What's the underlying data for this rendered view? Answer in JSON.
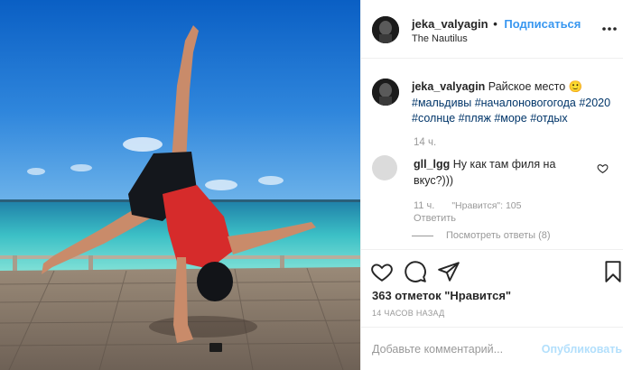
{
  "post": {
    "username": "jeka_valyagin",
    "dot": "•",
    "follow_label": "Подписаться",
    "location": "The Nautilus"
  },
  "caption": {
    "username": "jeka_valyagin",
    "text": "Райское место",
    "emoji": "🙂",
    "hashtags": [
      "#мальдивы",
      "#началоновогогода",
      "#2020",
      "#солнце",
      "#пляж",
      "#море",
      "#отдых"
    ],
    "time": "14 ч."
  },
  "comments": [
    {
      "username": "gll_lgg",
      "text": "Ну как там филя на вкус?)))",
      "time": "11 ч.",
      "likes": "\"Нравится\": 105",
      "reply_label": "Ответить",
      "view_replies": "Посмотреть ответы (8)"
    }
  ],
  "actions": {
    "likes_count": "363 отметок \"Нравится\"",
    "post_time": "14 ЧАСОВ НАЗАД"
  },
  "add_comment": {
    "placeholder": "Добавьте комментарий...",
    "publish_label": "Опубликовать"
  },
  "colors": {
    "link_blue": "#3897f0",
    "hashtag": "#003569",
    "muted": "#999999",
    "publish_disabled": "#b2dffc"
  }
}
